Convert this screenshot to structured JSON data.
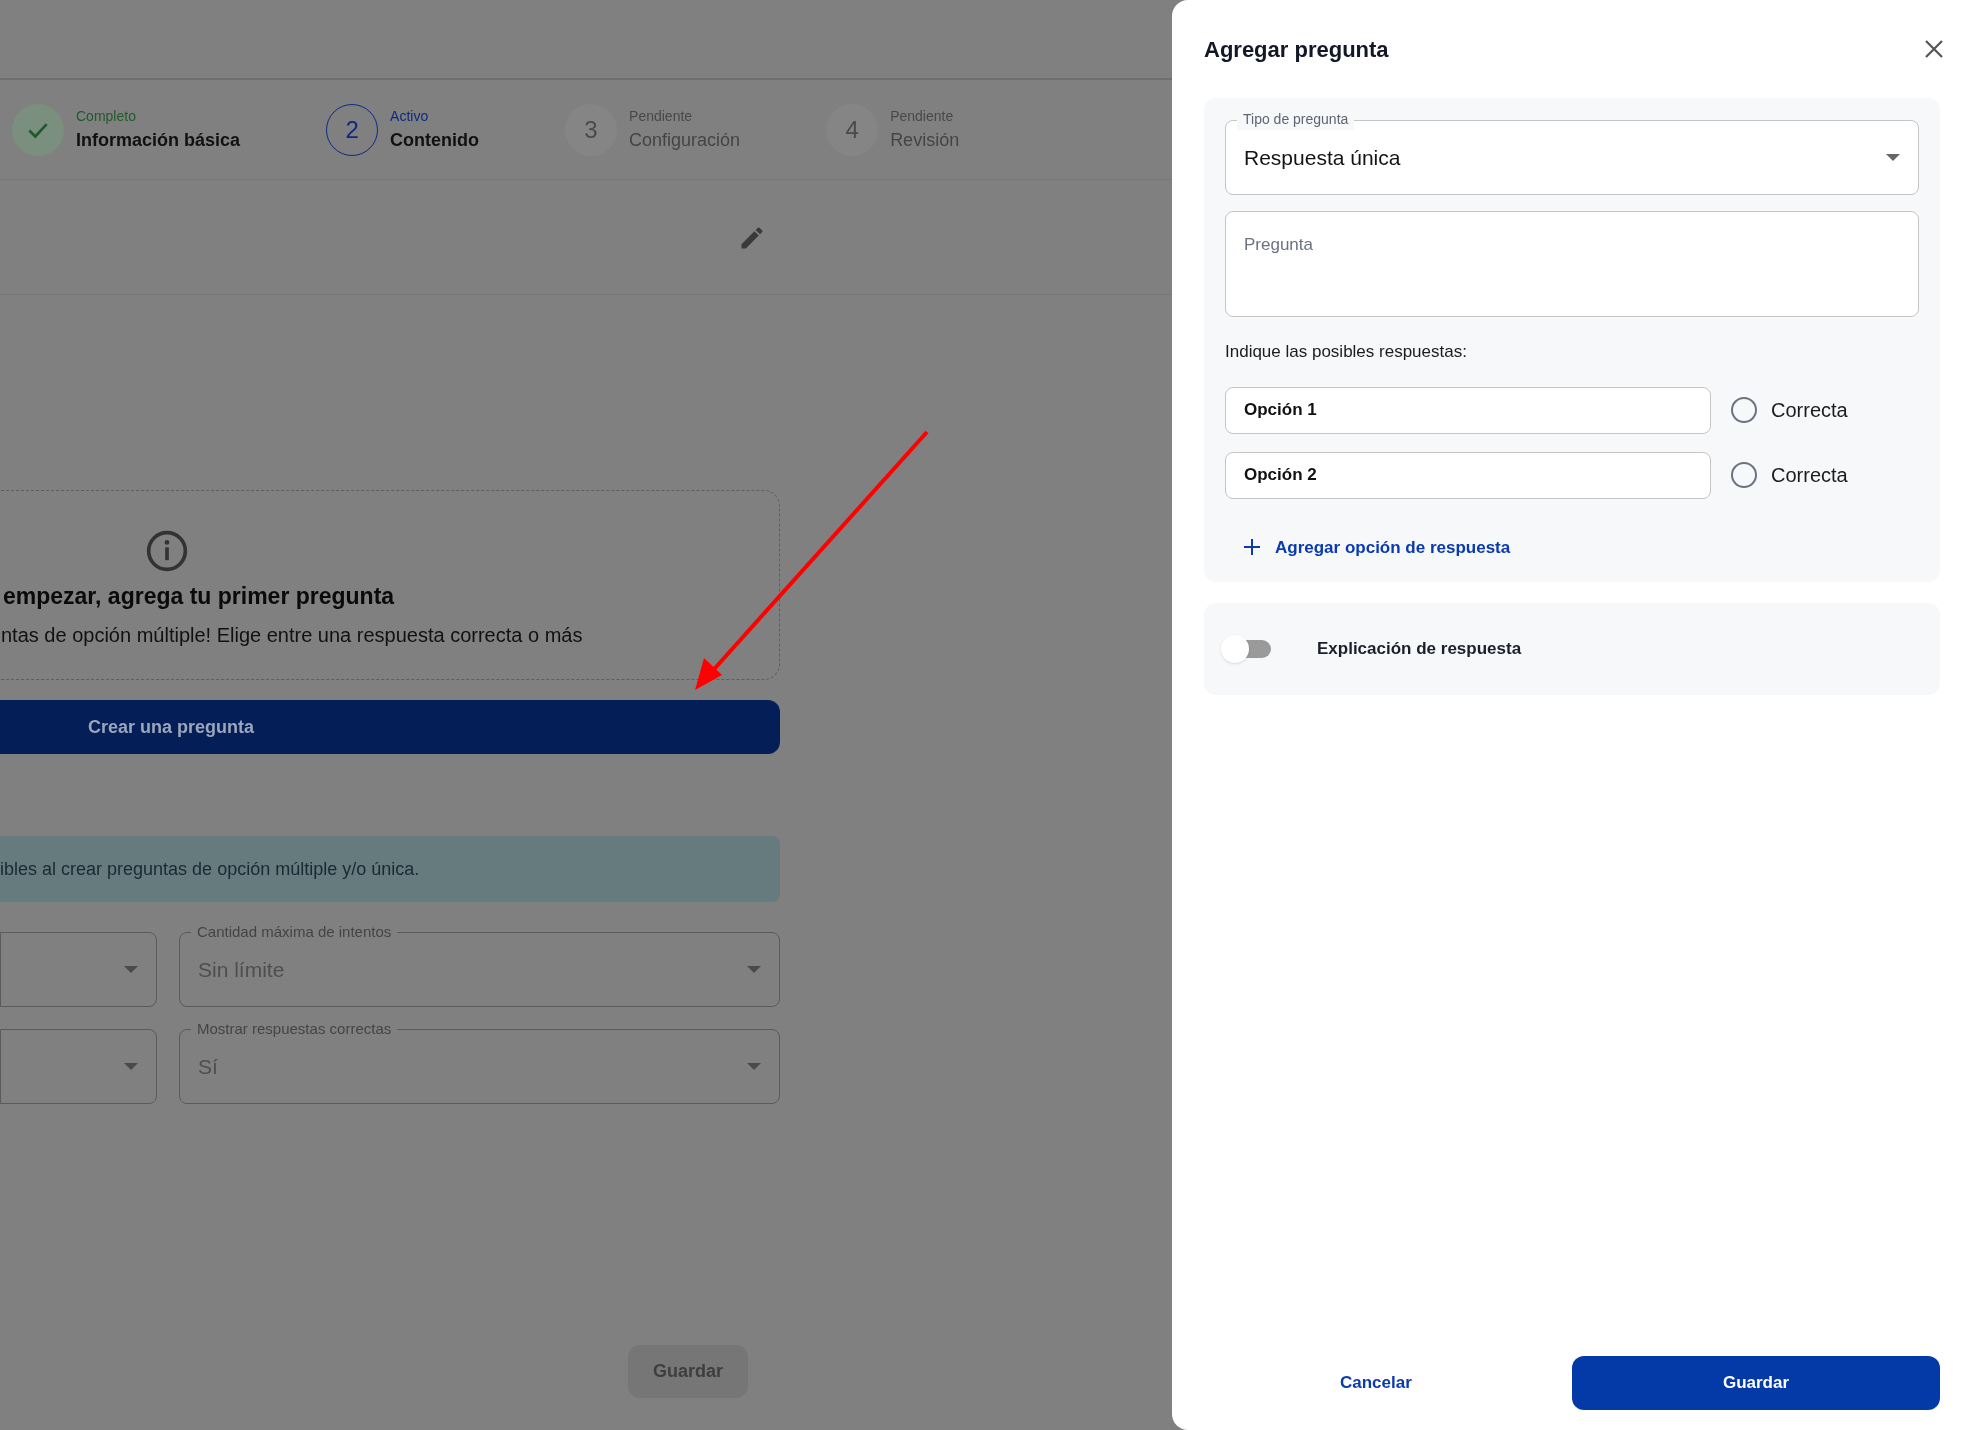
{
  "stepper": [
    {
      "kind": "complete",
      "caption": "Completo",
      "title": "Información básica"
    },
    {
      "kind": "active",
      "caption": "Activo",
      "title": "Contenido",
      "number": "2"
    },
    {
      "kind": "pending",
      "caption": "Pendiente",
      "title": "Configuración",
      "number": "3"
    },
    {
      "kind": "pending",
      "caption": "Pendiente",
      "title": "Revisión",
      "number": "4"
    }
  ],
  "empty_state": {
    "title": "empezar, agrega tu primer pregunta",
    "text": "ntas de opción múltiple! Elige entre una respuesta correcta o más"
  },
  "create_button": "Crear una pregunta",
  "alert": "ibles al crear preguntas de opción múltiple y/o única.",
  "settings": [
    {
      "label": "Cantidad máxima de intentos",
      "value": "Sin límite"
    },
    {
      "label": "Mostrar respuestas correctas",
      "value": "Sí"
    }
  ],
  "page_save": {
    "label": "Guardar",
    "disabled": true
  },
  "drawer": {
    "title": "Agregar pregunta",
    "type_select": {
      "label": "Tipo de pregunta",
      "value": "Respuesta única"
    },
    "question": {
      "placeholder": "Pregunta"
    },
    "answers_label": "Indique las posibles respuestas:",
    "options": [
      {
        "value": "Opción 1",
        "radio_label": "Correcta",
        "checked": false
      },
      {
        "value": "Opción 2",
        "radio_label": "Correcta",
        "checked": false
      }
    ],
    "add_option": "Agregar opción de respuesta",
    "explanation": {
      "label": "Explicación de respuesta",
      "on": false
    },
    "cancel": "Cancelar",
    "save": "Guardar"
  }
}
